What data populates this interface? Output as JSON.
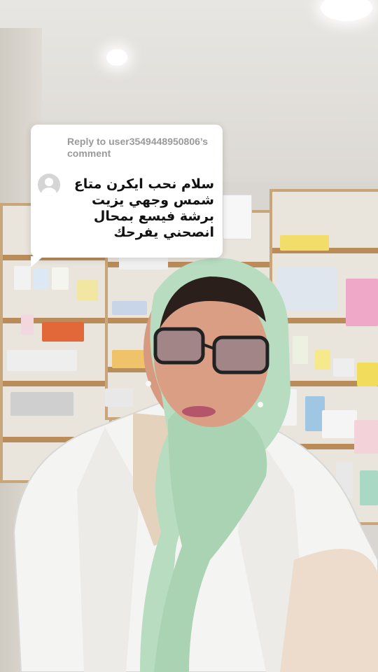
{
  "reply_card": {
    "reply_label": "Reply to user3549448950806’s comment",
    "comment_text": "سلام نحب ايكرن متاع شمس وجهي يزيت برشة فيسع بمحال انصحني يفرحك"
  },
  "colors": {
    "card_bg": "#ffffff",
    "reply_label": "#9a9a9a",
    "comment_text": "#111111",
    "avatar": "#d5d5d5",
    "scarf": "#b8dcc0",
    "coat": "#f4f4f2",
    "shelf_wood": "#b98c5a"
  },
  "icons": {
    "avatar": "default-user-avatar-icon"
  }
}
